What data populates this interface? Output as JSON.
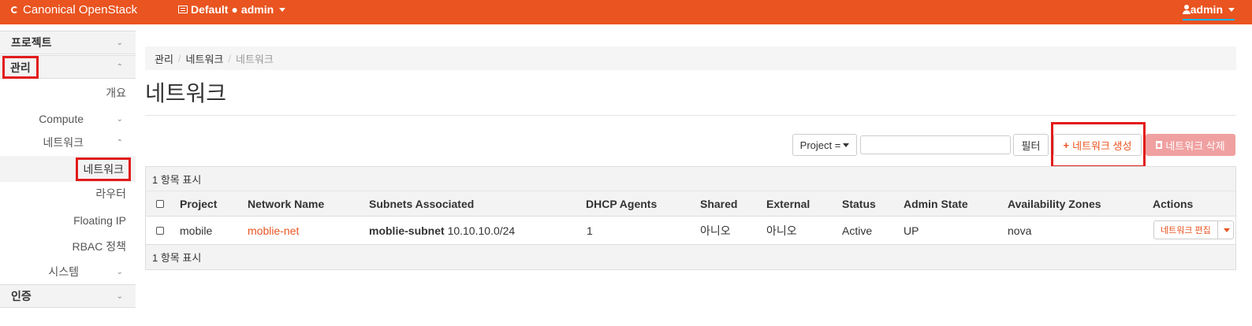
{
  "topbar": {
    "brand": "Canonical OpenStack",
    "context_domain": "Default",
    "context_sep": "●",
    "context_project": "admin",
    "user": "admin"
  },
  "sidebar": {
    "project": "프로젝트",
    "admin": "관리",
    "overview": "개요",
    "compute": "Compute",
    "network_group": "네트워크",
    "networks": "네트워크",
    "routers": "라우터",
    "floating_ip": "Floating IP",
    "rbac": "RBAC 정책",
    "system": "시스템",
    "identity": "인증"
  },
  "breadcrumb": {
    "items": [
      "관리",
      "네트워크",
      "네트워크"
    ],
    "sep": "/"
  },
  "page": {
    "title": "네트워크"
  },
  "toolbar": {
    "filter_select": "Project =",
    "filter_button": "필터",
    "create_button": "네트워크 생성",
    "delete_button": "네트워크 삭제"
  },
  "table": {
    "count_text": "1 항목 표시",
    "headers": [
      "Project",
      "Network Name",
      "Subnets Associated",
      "DHCP Agents",
      "Shared",
      "External",
      "Status",
      "Admin State",
      "Availability Zones",
      "Actions"
    ],
    "rows": [
      {
        "project": "mobile",
        "network_name": "moblie-net",
        "subnet_name": "moblie-subnet",
        "subnet_cidr": "10.10.10.0/24",
        "dhcp_agents": "1",
        "shared": "아니오",
        "external": "아니오",
        "status": "Active",
        "admin_state": "UP",
        "availability_zones": "nova",
        "action_label": "네트워크 편집"
      }
    ]
  },
  "colors": {
    "brand": "#e95420",
    "highlight": "#e21b1b"
  }
}
